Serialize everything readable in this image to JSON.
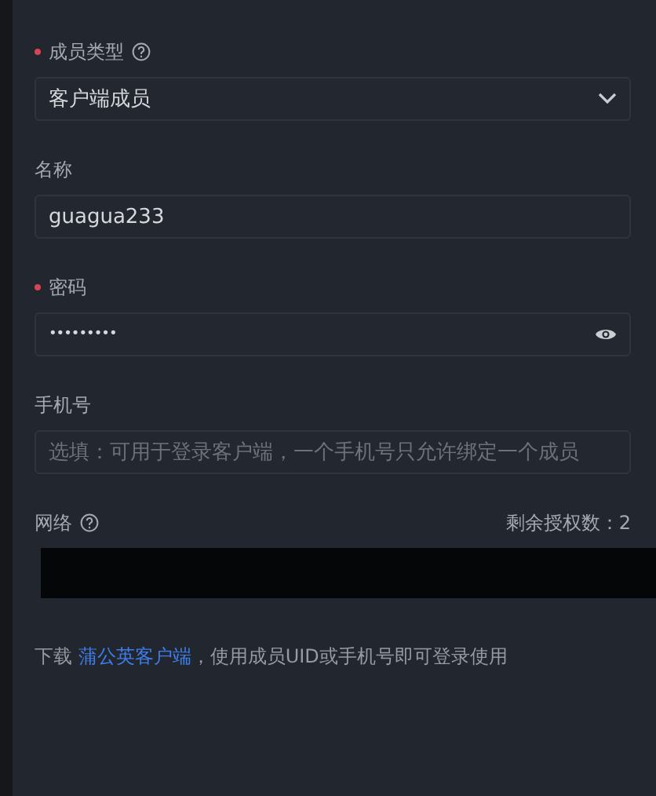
{
  "fields": [
    {
      "kind": "select",
      "label": "成员类型",
      "required": true,
      "help": true,
      "value": "客户端成员"
    },
    {
      "kind": "text",
      "label": "名称",
      "required": false,
      "help": false,
      "value": "guagua233"
    },
    {
      "kind": "password",
      "label": "密码",
      "required": true,
      "help": false,
      "value": "•••••••••"
    },
    {
      "kind": "text",
      "label": "手机号",
      "required": false,
      "help": false,
      "placeholder": "选填：可用于登录客户端，一个手机号只允许绑定一个成员"
    },
    {
      "kind": "network",
      "label": "网络",
      "required": false,
      "help": true,
      "aside": "剩余授权数：2"
    }
  ],
  "footer": {
    "before": "下载",
    "link": "蒲公英客户端",
    "after": "，使用成员UID或手机号即可登录使用"
  }
}
